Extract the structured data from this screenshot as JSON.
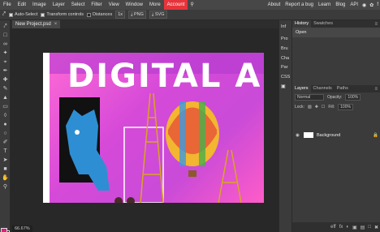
{
  "menu": {
    "items": [
      "File",
      "Edit",
      "Image",
      "Layer",
      "Select",
      "Filter",
      "View",
      "Window",
      "More"
    ],
    "account": "Account",
    "right_items": [
      "About",
      "Report a bug",
      "Learn",
      "Blog",
      "API"
    ],
    "search_icon": "search-icon",
    "accent": "#e5343b"
  },
  "options": {
    "auto_select": "Auto-Select",
    "transform_controls": "Transform controls",
    "distances": "Distances",
    "zoom_btn": "1x",
    "png_btn": "PNG",
    "svg_btn": "SVG"
  },
  "document": {
    "tab_label": "New Project.psd",
    "close": "×",
    "zoom": "66.67%",
    "title_text": "DIGITAL ART"
  },
  "strip": {
    "items": [
      "Inf",
      "Pro",
      "Bru",
      "Cha",
      "Par",
      "CSS"
    ]
  },
  "history_panel": {
    "tabs": [
      "History",
      "Swatches"
    ],
    "rows": [
      "Open"
    ]
  },
  "layers_panel": {
    "tabs": [
      "Layers",
      "Channels",
      "Paths"
    ],
    "blend_mode": "Normal",
    "opacity_label": "Opacity:",
    "opacity": "100%",
    "lock_label": "Lock:",
    "fill_label": "Fill:",
    "fill": "100%",
    "layer_name": "Background"
  },
  "footer": {
    "labels": [
      "eff",
      "fx"
    ]
  },
  "colors": {
    "foreground": "#d4267a",
    "background": "#111111"
  }
}
